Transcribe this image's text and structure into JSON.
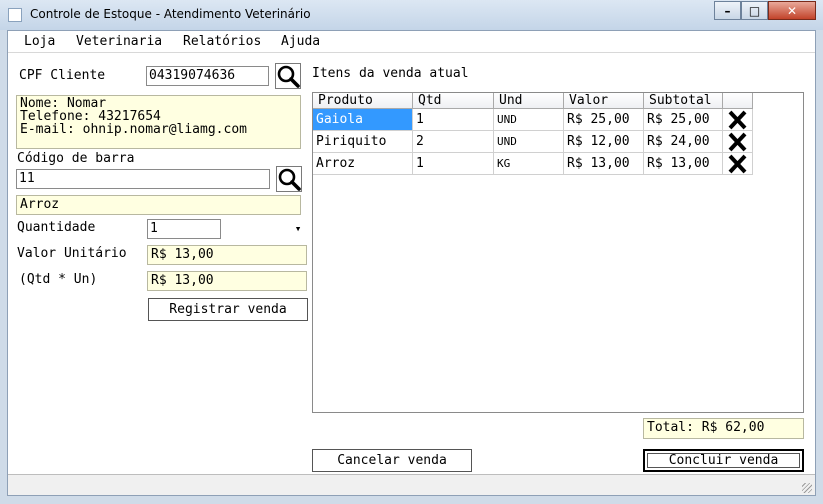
{
  "window": {
    "title": "Controle de Estoque - Atendimento Veterinário",
    "minimize_glyph": "–",
    "maximize_glyph": "□",
    "close_glyph": "✕"
  },
  "menu": [
    "Loja",
    "Veterinaria",
    "Relatórios",
    "Ajuda"
  ],
  "customer": {
    "cpf_label": "CPF Cliente",
    "cpf_value": "04319074636",
    "info_lines": [
      "Nome: Nomar",
      "Telefone: 43217654",
      "E-mail: ohnip.nomar@liamg.com"
    ]
  },
  "barcode": {
    "label": "Código de barra",
    "value": "11",
    "product_name": "Arroz"
  },
  "quantity": {
    "label": "Quantidade",
    "value": "1",
    "dropdown_glyph": "▾"
  },
  "unit_price": {
    "label": "Valor Unitário",
    "value": "R$ 13,00"
  },
  "line_total": {
    "label": "(Qtd * Un)",
    "value": "R$ 13,00"
  },
  "register_button": "Registrar venda",
  "items_title": "Itens da venda atual",
  "table": {
    "headers": [
      "Produto",
      "Qtd",
      "Und",
      "Valor",
      "Subtotal",
      ""
    ],
    "rows": [
      {
        "produto": "Gaiola",
        "qtd": "1",
        "und": "UND",
        "valor": "R$ 25,00",
        "subtotal": "R$ 25,00",
        "selected": true
      },
      {
        "produto": "Piriquito",
        "qtd": "2",
        "und": "UND",
        "valor": "R$ 12,00",
        "subtotal": "R$ 24,00",
        "selected": false
      },
      {
        "produto": "Arroz",
        "qtd": "1",
        "und": "KG",
        "valor": "R$ 13,00",
        "subtotal": "R$ 13,00",
        "selected": false
      }
    ]
  },
  "total": "Total: R$ 62,00",
  "cancel_button": "Cancelar venda",
  "finish_button": "Concluir venda",
  "colors": {
    "field_highlight": "#ffffe1",
    "selection": "#3399ff",
    "delete_icon": "#000000"
  },
  "icons": {
    "search": "search-icon",
    "delete": "delete-icon"
  }
}
